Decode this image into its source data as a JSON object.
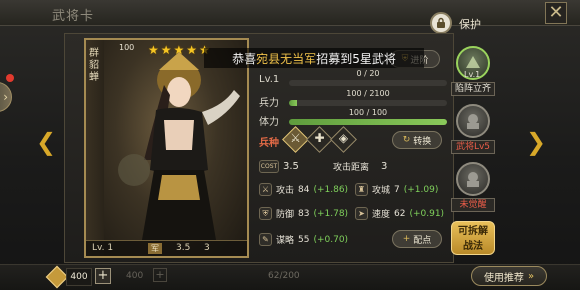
{
  "window": {
    "title": "武将卡",
    "protect_label": "保护",
    "close_glyph": "✕"
  },
  "nav": {
    "side_expand": "›",
    "prev": "❮",
    "next": "❯"
  },
  "card": {
    "faction": "群",
    "name": "貂蝉",
    "cost": "100",
    "stars": 5,
    "level": "Lv. 1",
    "chip": "军",
    "stat_a": "3.5",
    "stat_b": "3"
  },
  "toast": {
    "prefix": "恭喜",
    "highlight": "宛县无当军",
    "suffix": "招募到5星武将"
  },
  "advance": {
    "label": "进阶",
    "icon": "⛨"
  },
  "stats": {
    "level_label": "Lv.1",
    "exp_text": "0 / 20",
    "exp_fraction": 0.0,
    "troops_label": "兵力",
    "troops_text": "100 / 2100",
    "troops_fraction": 0.05,
    "stamina_label": "体力",
    "stamina_text": "100 / 100",
    "stamina_fraction": 1.0
  },
  "troop_type": {
    "label": "兵种",
    "icons": [
      "⚔",
      "✚",
      "◈"
    ],
    "switch_label": "转换"
  },
  "attributes": {
    "cost_label": "COST",
    "cost_value": "3.5",
    "range_label": "攻击距离",
    "range_value": "3",
    "attack": {
      "label": "攻击",
      "value": "84",
      "bonus": "(+1.86)"
    },
    "siege": {
      "label": "攻城",
      "value": "7",
      "bonus": "(+1.09)"
    },
    "defense": {
      "label": "防御",
      "value": "83",
      "bonus": "(+1.78)"
    },
    "speed": {
      "label": "速度",
      "value": "62",
      "bonus": "(+0.91)"
    },
    "strategy": {
      "label": "谋略",
      "value": "55",
      "bonus": "(+0.70)"
    },
    "add_points_label": "配点"
  },
  "dismantle": {
    "line1": "可拆解",
    "line2": "战法"
  },
  "skills": [
    {
      "level": "Lv.1",
      "name": "陷阵立齐",
      "state": "active"
    },
    {
      "level": "",
      "name": "武将Lv5",
      "state": "locked"
    },
    {
      "level": "",
      "name": "未觉醒",
      "state": "locked"
    }
  ],
  "bottom": {
    "resource_value": "400",
    "ghost_value": "400",
    "page_count": "62/200",
    "recommend_label": "使用推荐",
    "recommend_icon": "»"
  }
}
